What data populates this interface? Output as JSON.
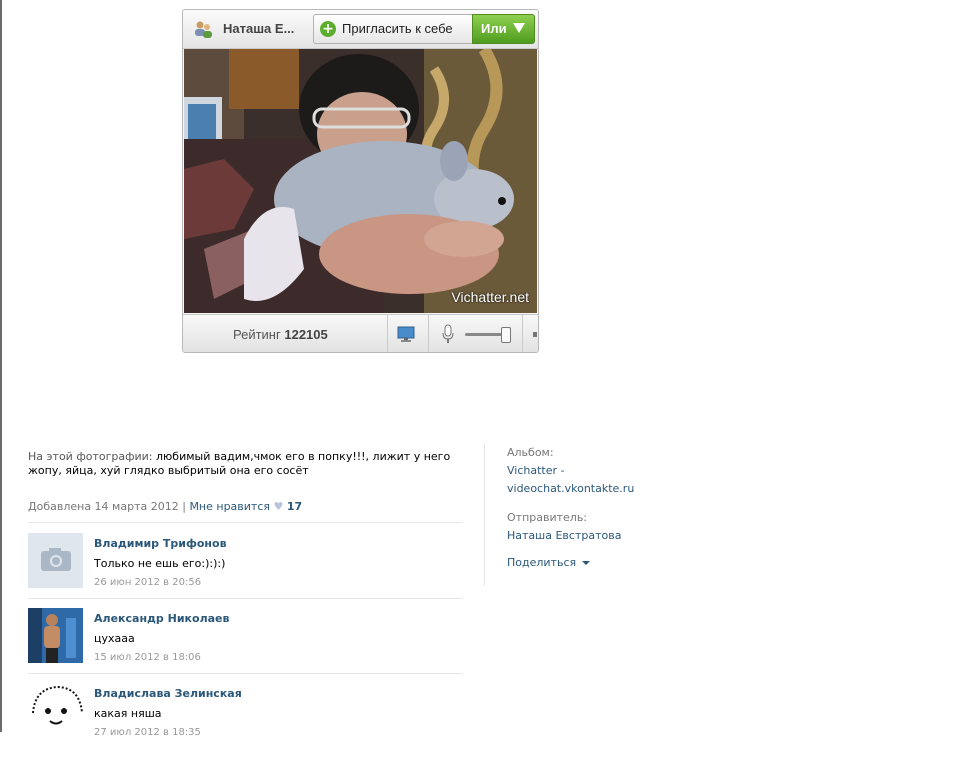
{
  "widget": {
    "user_name": "Наташа Е...",
    "invite_label": "Пригласить к себе",
    "or_label": "Или",
    "watermark": "Vichatter.net",
    "rating_label": "Рейтинг",
    "rating_value": "122105",
    "icons": [
      "users-icon",
      "plus-icon",
      "dropdown-arrow-icon",
      "monitor-icon",
      "microphone-icon",
      "volume-slider"
    ],
    "accent_green": "#5dad2f"
  },
  "photo": {
    "description_label": "На этой фотографии:",
    "description_text": "любимый вадим,чмок его в попку!!!, лижит у него жопу, яйца, хуй глядко выбритый она его сосёт",
    "added": "Добавлена 14 марта 2012",
    "separator": "|",
    "like_label": "Мне нравится",
    "like_count": "17"
  },
  "comments": [
    {
      "author": "Владимир Трифонов",
      "text": "Только не ешь его:):):)",
      "date": "26 июн 2012 в 20:56",
      "avatar": "camera-placeholder-icon"
    },
    {
      "author": "Александр Николаев",
      "text": "цухааа",
      "date": "15 июл 2012 в 18:06",
      "avatar": "photo"
    },
    {
      "author": "Владислава Зелинская",
      "text": "какая няша",
      "date": "27 июл 2012 в 18:35",
      "avatar": "drawing"
    }
  ],
  "sidebar": {
    "album_label": "Альбом:",
    "album_line1": "Vichatter -",
    "album_line2": "videochat.vkontakte.ru",
    "sender_label": "Отправитель:",
    "sender_name": "Наташа Евстратова",
    "share_label": "Поделиться"
  },
  "colors": {
    "link": "#2b587a",
    "muted": "#777777"
  }
}
